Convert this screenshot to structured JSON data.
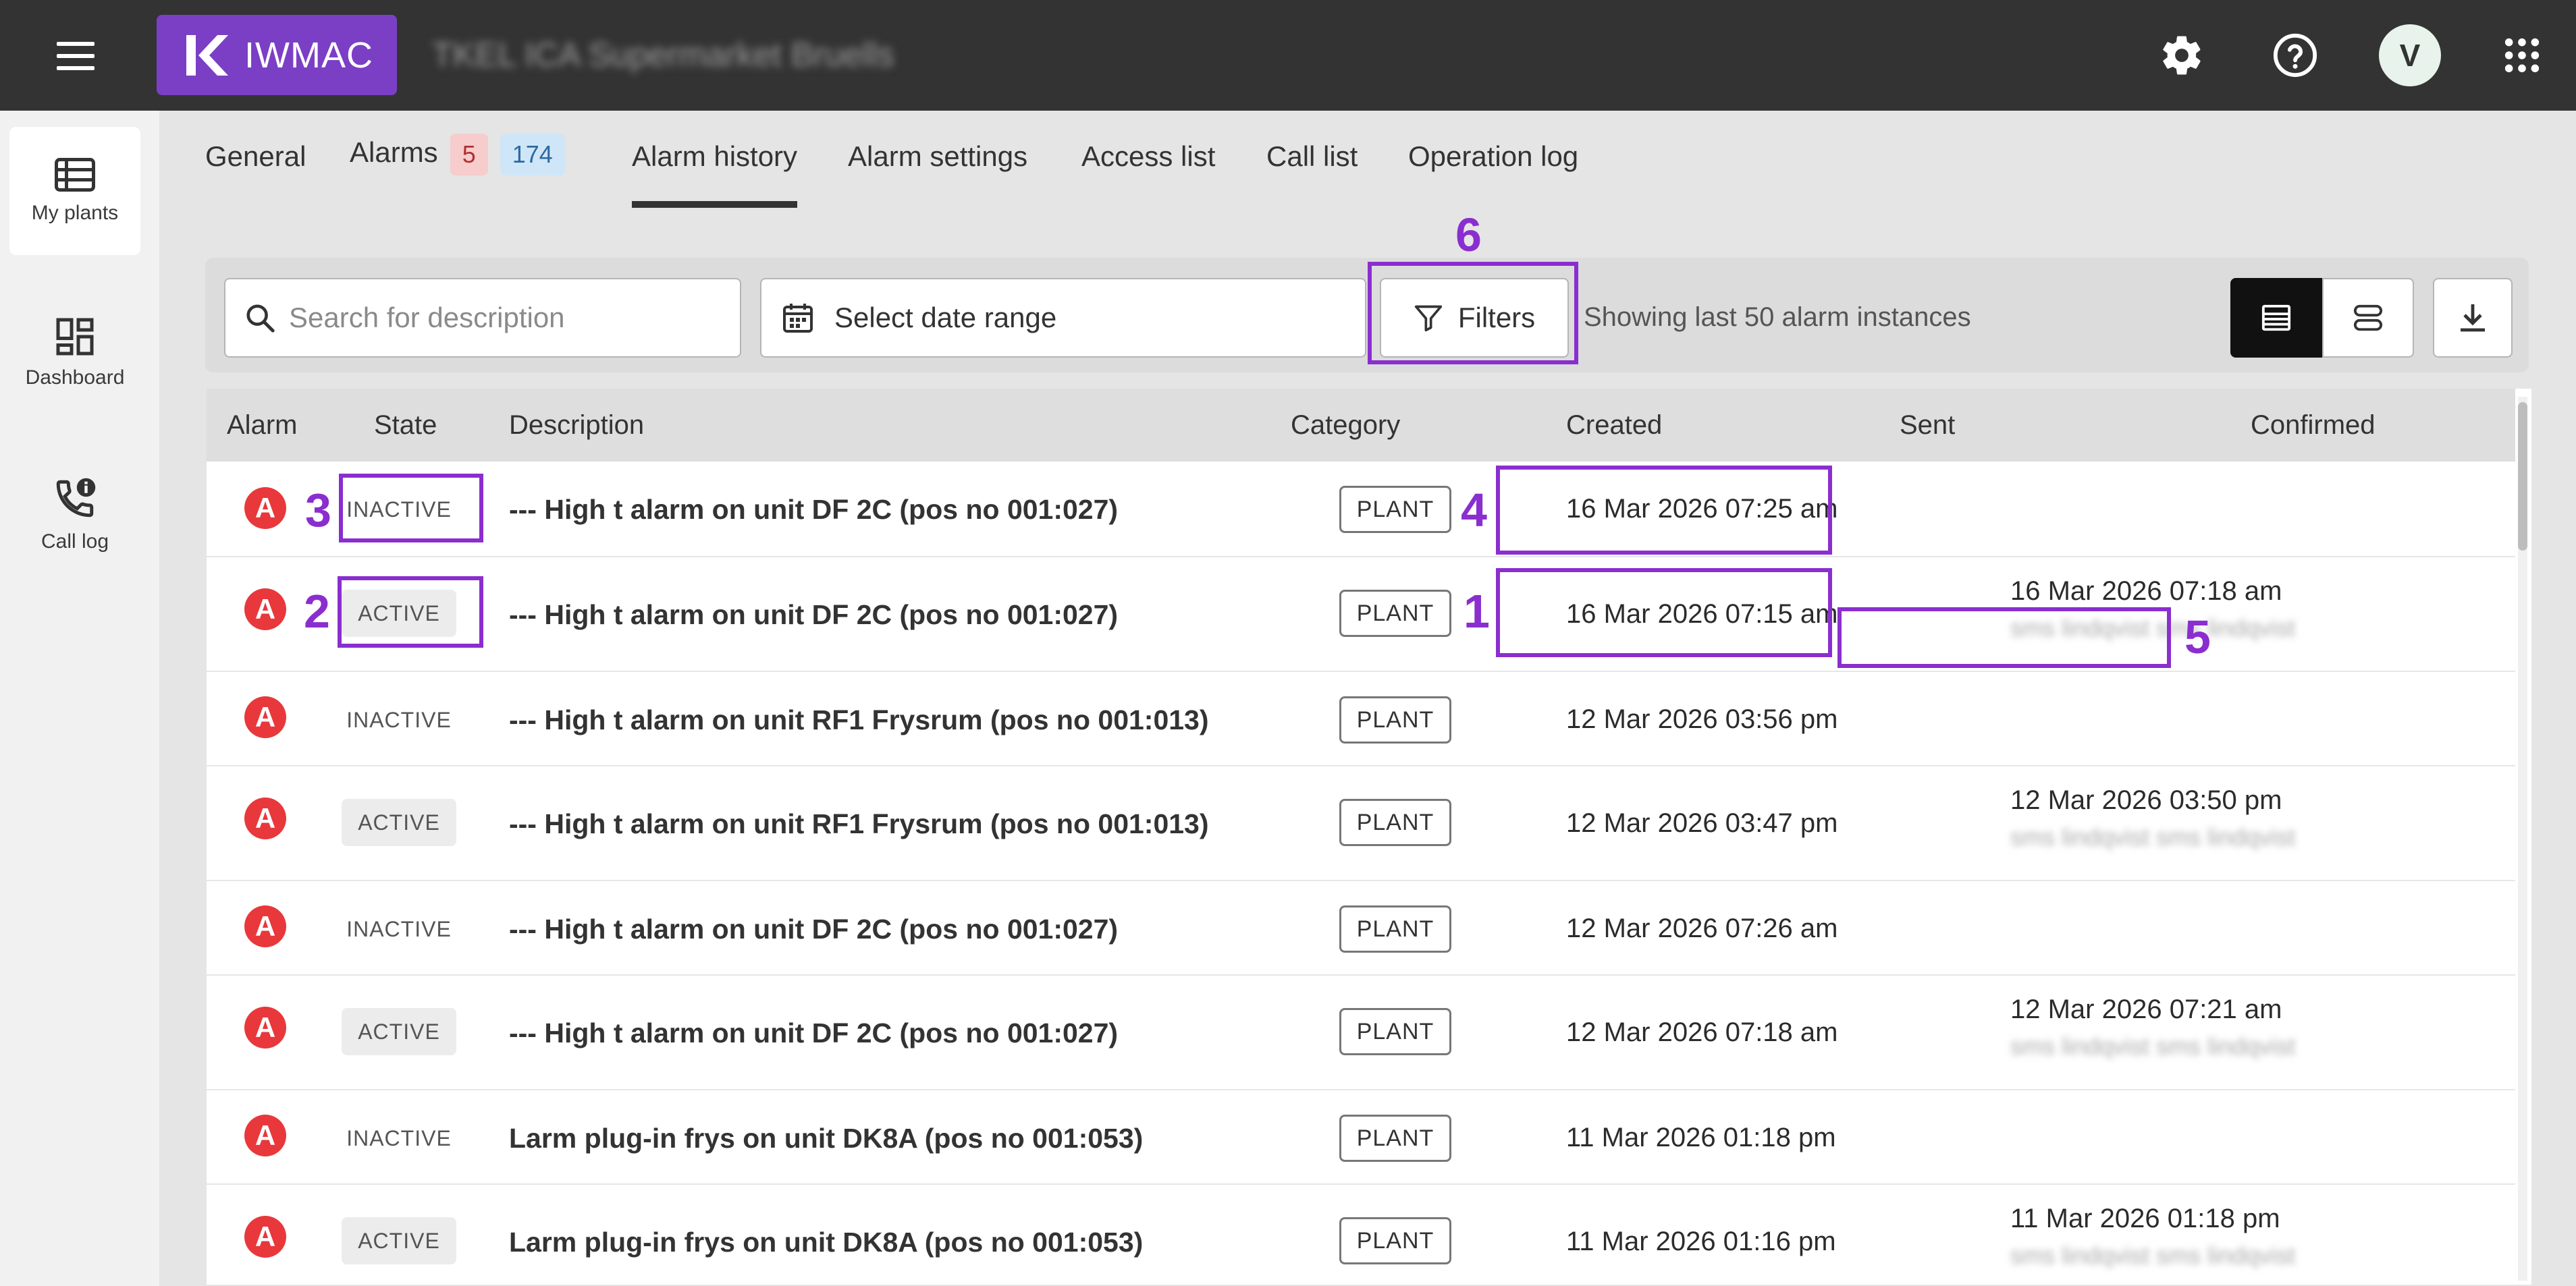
{
  "app": {
    "brand": "IWMAC",
    "plant_name": "TKEL ICA Supermarket Bruells",
    "avatar_letter": "V"
  },
  "sidebar": {
    "items": [
      {
        "label": "My plants",
        "icon": "list-icon"
      },
      {
        "label": "Dashboard",
        "icon": "dashboard-icon"
      },
      {
        "label": "Call log",
        "icon": "phone-info-icon"
      }
    ]
  },
  "tabs": {
    "general": "General",
    "alarms": "Alarms",
    "alarms_badge_red": "5",
    "alarms_badge_blue": "174",
    "alarm_history": "Alarm history",
    "alarm_settings": "Alarm settings",
    "access_list": "Access list",
    "call_list": "Call list",
    "operation_log": "Operation log"
  },
  "toolbar": {
    "search_placeholder": "Search for description",
    "date_range_label": "Select date range",
    "filters_label": "Filters",
    "showing_text": "Showing last 50 alarm instances"
  },
  "table": {
    "headers": {
      "alarm": "Alarm",
      "state": "State",
      "description": "Description",
      "category": "Category",
      "created": "Created",
      "sent": "Sent",
      "confirmed": "Confirmed"
    },
    "rows": [
      {
        "icon": "A",
        "state": "INACTIVE",
        "description": "--- High t alarm on unit DF 2C (pos no  001:027)",
        "category": "PLANT",
        "created": "16 Mar  2026 07:25 am",
        "sent": "",
        "sent_sub": ""
      },
      {
        "icon": "A",
        "state": "ACTIVE",
        "description": "--- High t alarm on unit DF 2C (pos no  001:027)",
        "category": "PLANT",
        "created": "16 Mar  2026 07:15 am",
        "sent": "16 Mar  2026 07:18 am",
        "sent_sub": "sms lindqvist sms lindqvist"
      },
      {
        "icon": "A",
        "state": "INACTIVE",
        "description": "--- High t alarm on unit RF1 Frysrum (pos no  001:013)",
        "category": "PLANT",
        "created": "12 Mar  2026 03:56 pm",
        "sent": "",
        "sent_sub": ""
      },
      {
        "icon": "A",
        "state": "ACTIVE",
        "description": "--- High t alarm on unit RF1 Frysrum (pos no  001:013)",
        "category": "PLANT",
        "created": "12 Mar  2026 03:47 pm",
        "sent": "12 Mar  2026 03:50 pm",
        "sent_sub": "sms lindqvist sms lindqvist"
      },
      {
        "icon": "A",
        "state": "INACTIVE",
        "description": "--- High t alarm on unit DF 2C (pos no  001:027)",
        "category": "PLANT",
        "created": "12 Mar  2026 07:26 am",
        "sent": "",
        "sent_sub": ""
      },
      {
        "icon": "A",
        "state": "ACTIVE",
        "description": "--- High t alarm on unit DF 2C (pos no  001:027)",
        "category": "PLANT",
        "created": "12 Mar  2026 07:18 am",
        "sent": "12 Mar  2026 07:21 am",
        "sent_sub": "sms lindqvist sms lindqvist"
      },
      {
        "icon": "A",
        "state": "INACTIVE",
        "description": "Larm plug-in frys on unit DK8A (pos no  001:053)",
        "category": "PLANT",
        "created": "11 Mar  2026 01:18 pm",
        "sent": "",
        "sent_sub": ""
      },
      {
        "icon": "A",
        "state": "ACTIVE",
        "description": "Larm plug-in frys on unit DK8A (pos no  001:053)",
        "category": "PLANT",
        "created": "11 Mar  2026 01:16 pm",
        "sent": "11 Mar  2026 01:18 pm",
        "sent_sub": "sms lindqvist sms lindqvist"
      }
    ]
  },
  "annotations": {
    "n1": "1",
    "n2": "2",
    "n3": "3",
    "n4": "4",
    "n5": "5",
    "n6": "6",
    "color": "#8a2ecf"
  },
  "colors": {
    "brand": "#7b3fc6",
    "topbar": "#333333",
    "alarm_icon": "#e8383b"
  }
}
